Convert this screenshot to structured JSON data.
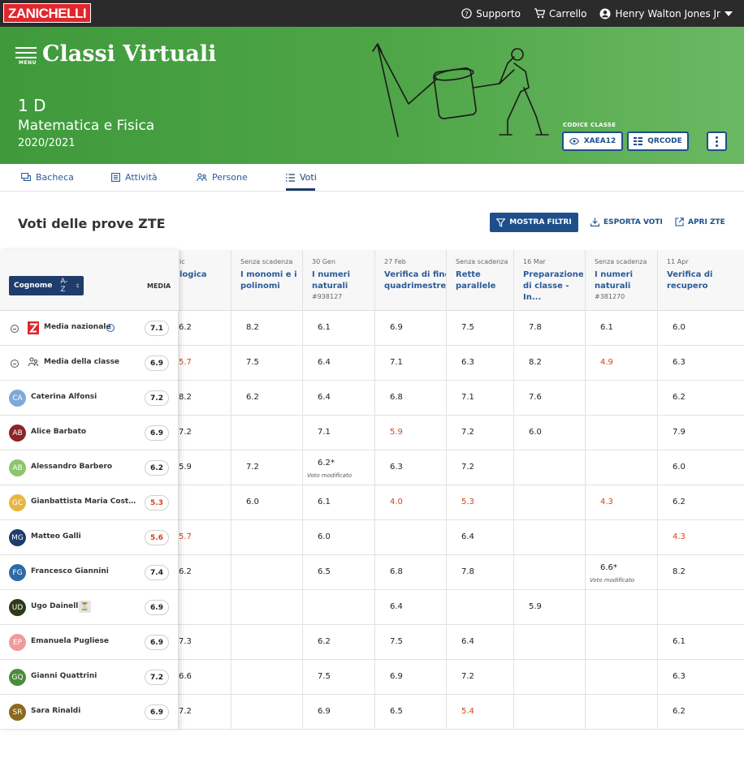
{
  "topbar": {
    "logo": "ZANICHELLI",
    "support": "Supporto",
    "cart": "Carrello",
    "user": "Henry Walton Jones Jr"
  },
  "hero": {
    "menu_label": "MENU",
    "app_title": "Classi Virtuali",
    "class_name": "1 D",
    "subject": "Matematica e Fisica",
    "year": "2020/2021",
    "code_label": "CODICE CLASSE",
    "class_code": "XAEA12",
    "qr_label": "QRCODE"
  },
  "tabs": [
    {
      "label": "Bacheca",
      "icon": "chat-icon"
    },
    {
      "label": "Attività",
      "icon": "list-box-icon"
    },
    {
      "label": "Persone",
      "icon": "people-icon"
    },
    {
      "label": "Voti",
      "icon": "list-icon",
      "active": true
    }
  ],
  "section": {
    "title": "Voti delle prove ZTE",
    "filter_label": "MOSTRA FILTRI",
    "export_label": "ESPORTA VOTI",
    "open_label": "APRI ZTE"
  },
  "grid": {
    "sort_label": "Cognome",
    "sort_order": "A-Z",
    "media_label": "MEDIA",
    "modified_note": "Voto modificato",
    "columns": [
      {
        "date": "ic",
        "title": "logica",
        "code": ""
      },
      {
        "date": "Senza scadenza",
        "title": "I monomi e i polinomi",
        "code": ""
      },
      {
        "date": "30 Gen",
        "title": "I numeri naturali",
        "code": "#938127"
      },
      {
        "date": "27 Feb",
        "title": "Verifica di fine quadrimestre",
        "code": ""
      },
      {
        "date": "Senza scadenza",
        "title": "Rette parallele",
        "code": ""
      },
      {
        "date": "16 Mar",
        "title": "Preparazione di classe - In...",
        "code": ""
      },
      {
        "date": "Senza scadenza",
        "title": "I numeri naturali",
        "code": "#381270"
      },
      {
        "date": "11 Apr",
        "title": "Verifica di recupero",
        "code": ""
      }
    ],
    "rows": [
      {
        "type": "national",
        "name": "Media nazionale",
        "avg": "7.1",
        "avg_low": false,
        "grades": [
          "6.2",
          "8.2",
          "6.1",
          "6.9",
          "7.5",
          "7.8",
          "6.1",
          "6.0"
        ],
        "low": [],
        "modified": []
      },
      {
        "type": "classavg",
        "name": "Media della classe",
        "avg": "6.9",
        "avg_low": false,
        "grades": [
          "5.7",
          "7.5",
          "6.4",
          "7.1",
          "6.3",
          "8.2",
          "4.9",
          "6.3"
        ],
        "low": [
          0,
          6
        ],
        "modified": []
      },
      {
        "type": "student",
        "initials": "CA",
        "color": "#7fa9d9",
        "name": "Caterina Alfonsi",
        "avg": "7.2",
        "avg_low": false,
        "grades": [
          "8.2",
          "6.2",
          "6.4",
          "6.8",
          "7.1",
          "7.6",
          "",
          "6.2"
        ],
        "low": [],
        "modified": []
      },
      {
        "type": "student",
        "initials": "AB",
        "color": "#8b2424",
        "name": "Alice Barbato",
        "avg": "6.9",
        "avg_low": false,
        "grades": [
          "7.2",
          "",
          "7.1",
          "5.9",
          "7.2",
          "6.0",
          "",
          "7.9"
        ],
        "low": [
          3
        ],
        "modified": []
      },
      {
        "type": "student",
        "initials": "AB",
        "color": "#8cc56c",
        "name": "Alessandro Barbero",
        "avg": "6.2",
        "avg_low": false,
        "grades": [
          "5.9",
          "7.2",
          "6.2*",
          "6.3",
          "7.2",
          "",
          "",
          "6.0"
        ],
        "low": [],
        "modified": [
          2
        ]
      },
      {
        "type": "student",
        "initials": "GC",
        "color": "#e8b63f",
        "name": "Gianbattista Maria Costacurta",
        "avg": "5.3",
        "avg_low": true,
        "grades": [
          "",
          "6.0",
          "6.1",
          "4.0",
          "5.3",
          "",
          "4.3",
          "6.2"
        ],
        "low": [
          3,
          4,
          6
        ],
        "modified": []
      },
      {
        "type": "student",
        "initials": "MG",
        "color": "#1e3d6b",
        "name": "Matteo Galli",
        "avg": "5.6",
        "avg_low": true,
        "grades": [
          "5.7",
          "",
          "6.0",
          "",
          "6.4",
          "",
          "",
          "4.3"
        ],
        "low": [
          0,
          7
        ],
        "modified": []
      },
      {
        "type": "student",
        "initials": "FG",
        "color": "#2f6aa8",
        "name": "Francesco Giannini",
        "avg": "7.4",
        "avg_low": false,
        "grades": [
          "6.2",
          "",
          "6.5",
          "6.8",
          "7.8",
          "",
          "6.6*",
          "8.2"
        ],
        "low": [],
        "modified": [
          6
        ]
      },
      {
        "type": "student",
        "initials": "UD",
        "color": "#2d3b16",
        "name": "Ugo Dainelli",
        "avg": "6.9",
        "avg_low": false,
        "pending": true,
        "grades": [
          "",
          "",
          "",
          "6.4",
          "",
          "5.9",
          "",
          ""
        ],
        "low": [],
        "modified": []
      },
      {
        "type": "student",
        "initials": "EP",
        "color": "#ef9a9a",
        "name": "Emanuela Pugliese",
        "avg": "6.9",
        "avg_low": false,
        "grades": [
          "7.3",
          "",
          "6.2",
          "7.5",
          "6.4",
          "",
          "",
          "6.1"
        ],
        "low": [],
        "modified": []
      },
      {
        "type": "student",
        "initials": "GQ",
        "color": "#4a8c3c",
        "name": "Gianni Quattrini",
        "avg": "7.2",
        "avg_low": false,
        "grades": [
          "6.6",
          "",
          "7.5",
          "6.9",
          "7.2",
          "",
          "",
          "6.3"
        ],
        "low": [],
        "modified": []
      },
      {
        "type": "student",
        "initials": "SR",
        "color": "#8a6a1e",
        "name": "Sara Rinaldi",
        "avg": "6.9",
        "avg_low": false,
        "grades": [
          "7.2",
          "",
          "6.9",
          "6.5",
          "5.4",
          "",
          "",
          "6.2"
        ],
        "low": [
          4
        ],
        "modified": []
      }
    ]
  }
}
